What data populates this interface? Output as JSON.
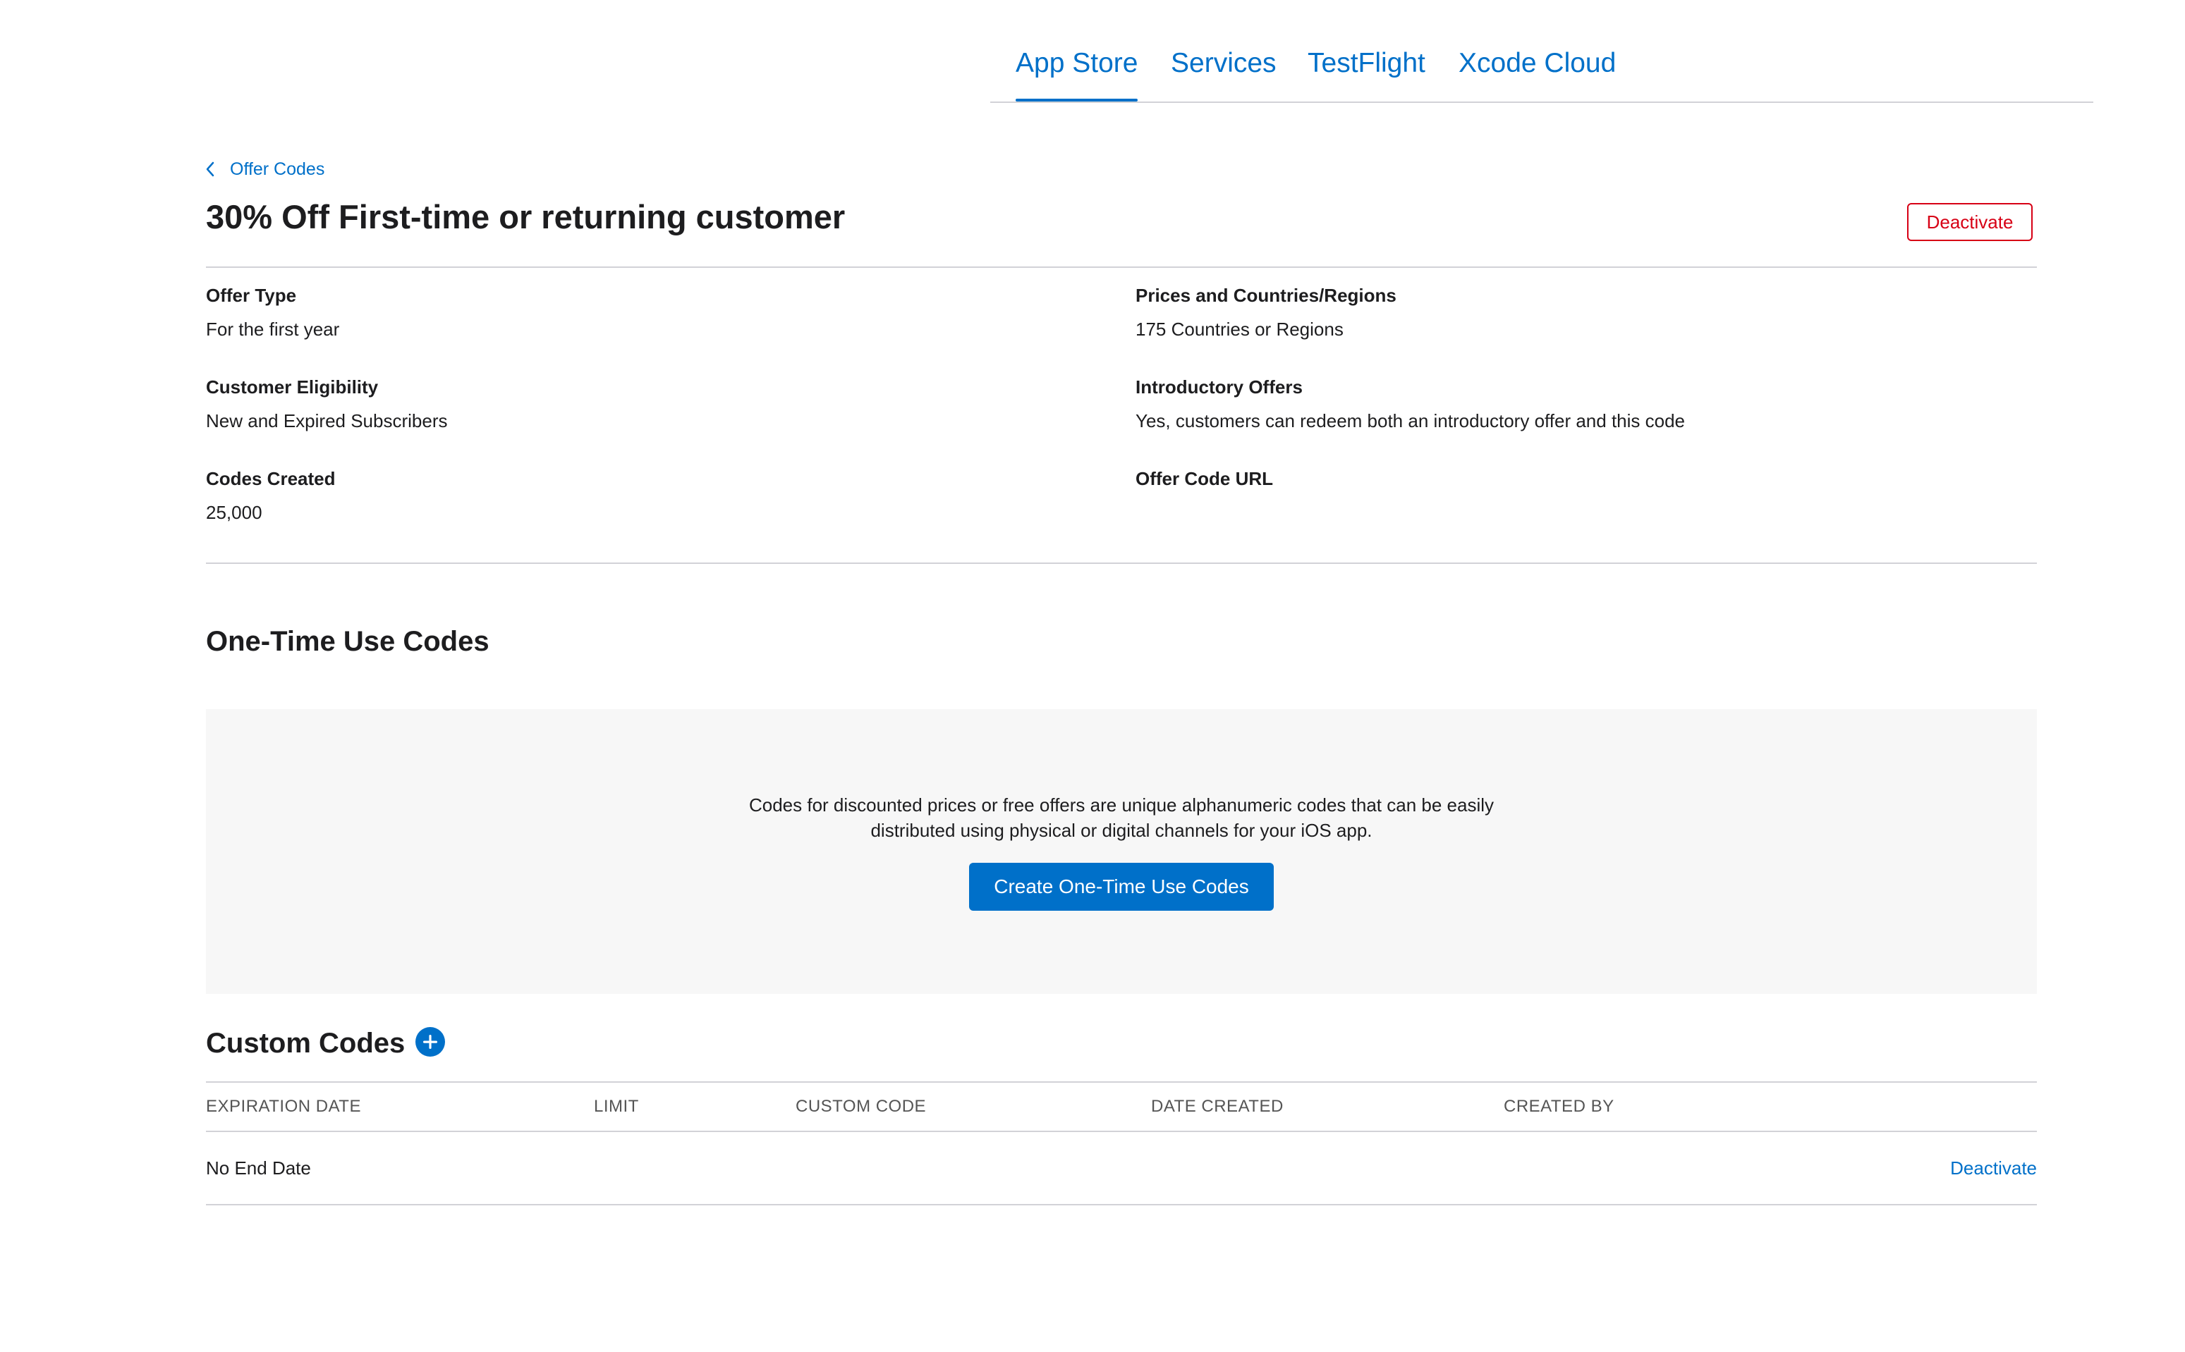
{
  "nav": {
    "tabs": [
      {
        "label": "App Store",
        "active": true
      },
      {
        "label": "Services",
        "active": false
      },
      {
        "label": "TestFlight",
        "active": false
      },
      {
        "label": "Xcode Cloud",
        "active": false
      }
    ]
  },
  "breadcrumb": {
    "icon": "chevron-left-icon",
    "label": "Offer Codes"
  },
  "header": {
    "title": "30% Off First-time or returning customer",
    "deactivate_label": "Deactivate"
  },
  "details": {
    "offer_type": {
      "label": "Offer Type",
      "value": "For the first year"
    },
    "customer_eligibility": {
      "label": "Customer Eligibility",
      "value": "New and Expired Subscribers"
    },
    "codes_created": {
      "label": "Codes Created",
      "value": "25,000"
    },
    "prices": {
      "label": "Prices and Countries/Regions",
      "value": "175 Countries or Regions"
    },
    "introductory_offers": {
      "label": "Introductory Offers",
      "value": "Yes, customers can redeem both an introductory offer and this code"
    },
    "offer_code_url": {
      "label": "Offer Code URL",
      "value": ""
    }
  },
  "one_time": {
    "title": "One-Time Use Codes",
    "description_line1": "Codes for discounted prices or free offers are unique alphanumeric codes that can be easily",
    "description_line2": "distributed using physical or digital channels for your iOS app.",
    "button_label": "Create One-Time Use Codes"
  },
  "custom_codes": {
    "title": "Custom Codes",
    "add_icon": "plus-circle-icon",
    "columns": [
      "EXPIRATION DATE",
      "LIMIT",
      "CUSTOM CODE",
      "DATE CREATED",
      "CREATED BY"
    ],
    "rows": [
      {
        "expiration_date": "No End Date",
        "limit": "",
        "custom_code": "",
        "date_created": "",
        "created_by": "",
        "action_label": "Deactivate"
      }
    ]
  },
  "colors": {
    "accent": "#0070c9",
    "destructive": "#d70015",
    "divider": "#d2d2d7",
    "panel_bg": "#f7f7f7"
  }
}
